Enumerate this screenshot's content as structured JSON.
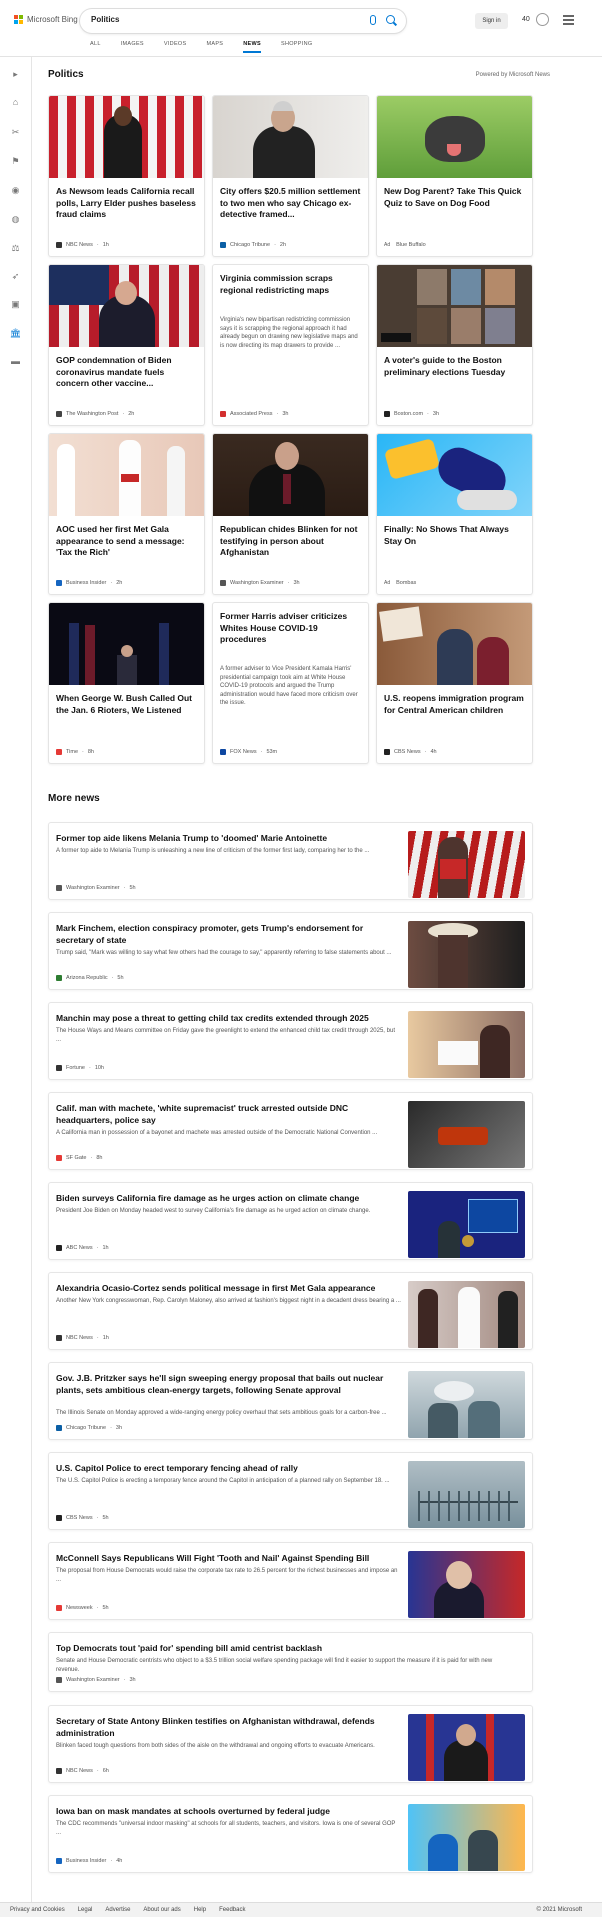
{
  "brand": {
    "name": "Microsoft Bing"
  },
  "search": {
    "query": "Politics"
  },
  "header": {
    "signin": "Sign in",
    "points": "40"
  },
  "tabs": [
    {
      "label": "ALL"
    },
    {
      "label": "IMAGES"
    },
    {
      "label": "VIDEOS"
    },
    {
      "label": "MAPS"
    },
    {
      "label": "NEWS",
      "active": true
    },
    {
      "label": "SHOPPING"
    }
  ],
  "section": {
    "title": "Politics",
    "powered": "Powered by Microsoft News"
  },
  "cards": [
    {
      "title": "As Newsom leads California recall polls, Larry Elder pushes baseless fraud claims",
      "source": "NBC News",
      "age": "1h"
    },
    {
      "title": "City offers $20.5 million settlement to two men who say Chicago ex-detective framed...",
      "source": "Chicago Tribune",
      "age": "2h"
    },
    {
      "title": "New Dog Parent? Take This Quick Quiz to Save on Dog Food",
      "source": "Blue Buffalo",
      "ad": "Ad"
    },
    {
      "title": "GOP condemnation of Biden coronavirus mandate fuels concern other vaccine...",
      "source": "The Washington Post",
      "age": "2h"
    },
    {
      "title": "Virginia commission scraps regional redistricting maps",
      "desc": "Virginia's new bipartisan redistricting commission says it is scrapping the regional approach it had already begun on drawing new legislative maps and is now directing its map drawers to provide ...",
      "source": "Associated Press",
      "age": "3h"
    },
    {
      "title": "A voter's guide to the Boston preliminary elections Tuesday",
      "source": "Boston.com",
      "age": "3h"
    },
    {
      "title": "AOC used her first Met Gala appearance to send a message: 'Tax the Rich'",
      "source": "Business Insider",
      "age": "2h"
    },
    {
      "title": "Republican chides Blinken for not testifying in person about Afghanistan",
      "source": "Washington Examiner",
      "age": "3h"
    },
    {
      "title": "Finally: No Shows That Always Stay On",
      "source": "Bombas",
      "ad": "Ad"
    },
    {
      "title": "When George W. Bush Called Out the Jan. 6 Rioters, We Listened",
      "source": "Time",
      "age": "8h"
    },
    {
      "title": "Former Harris adviser criticizes Whites House COVID-19 procedures",
      "desc": "A former adviser to Vice President Kamala Harris' presidential campaign took aim at White House COVID-19 protocols and argued the Trump administration would have faced more criticism over the issue.",
      "source": "FOX News",
      "age": "53m"
    },
    {
      "title": "U.S. reopens immigration program for Central American children",
      "source": "CBS News",
      "age": "4h"
    }
  ],
  "more": {
    "title": "More news"
  },
  "rows": [
    {
      "title": "Former top aide likens Melania Trump to 'doomed' Marie Antoinette",
      "desc": "A former top aide to Melania Trump is unleashing a new line of criticism of the former first lady, comparing her to the ...",
      "source": "Washington Examiner",
      "age": "5h"
    },
    {
      "title": "Mark Finchem, election conspiracy promoter, gets Trump's endorsement for secretary of state",
      "desc": "Trump said, \"Mark was willing to say what few others had the courage to say,\" apparently referring to false statements about ...",
      "source": "Arizona Republic",
      "age": "5h"
    },
    {
      "title": "Manchin may pose a threat to getting child tax credits extended through 2025",
      "desc": "The House Ways and Means committee on Friday gave the greenlight to extend the enhanced child tax credit through 2025, but ...",
      "source": "Fortune",
      "age": "10h"
    },
    {
      "title": "Calif. man with machete, 'white supremacist' truck arrested outside DNC headquarters, police say",
      "desc": "A California man in possession of a bayonet and machete was arrested outside of the Democratic National Convention ...",
      "source": "SF Gate",
      "age": "8h"
    },
    {
      "title": "Biden surveys California fire damage as he urges action on climate change",
      "desc": "President Joe Biden on Monday headed west to survey California's fire damage as he urged action on climate change.",
      "source": "ABC News",
      "age": "1h"
    },
    {
      "title": "Alexandria Ocasio-Cortez sends political message in first Met Gala appearance",
      "desc": "Another New York congresswoman, Rep. Carolyn Maloney, also arrived at fashion's biggest night in a decadent dress bearing a ...",
      "source": "NBC News",
      "age": "1h"
    },
    {
      "title": "Gov. J.B. Pritzker says he'll sign sweeping energy proposal that bails out nuclear plants, sets ambitious clean-energy targets, following Senate approval",
      "desc": "The Illinois Senate on Monday approved a wide-ranging energy policy overhaul that sets ambitious goals for a carbon-free ...",
      "source": "Chicago Tribune",
      "age": "3h"
    },
    {
      "title": "U.S. Capitol Police to erect temporary fencing ahead of rally",
      "desc": "The U.S. Capitol Police is erecting a temporary fence around the Capitol in anticipation of a planned rally on September 18. ...",
      "source": "CBS News",
      "age": "5h"
    },
    {
      "title": "McConnell Says Republicans Will Fight 'Tooth and Nail' Against Spending Bill",
      "desc": "The proposal from House Democrats would raise the corporate tax rate to 26.5 percent for the richest businesses and impose an ...",
      "source": "Newsweek",
      "age": "5h"
    },
    {
      "title": "Top Democrats tout 'paid for' spending bill amid centrist backlash",
      "desc": "Senate and House Democratic centrists who object to a $3.5 trillion social welfare spending package will find it easier to support the measure if it is paid for with new revenue.",
      "source": "Washington Examiner",
      "age": "3h"
    },
    {
      "title": "Secretary of State Antony Blinken testifies on Afghanistan withdrawal, defends administration",
      "desc": "Blinken faced tough questions from both sides of the aisle on the withdrawal and ongoing efforts to evacuate Americans.",
      "source": "NBC News",
      "age": "6h"
    },
    {
      "title": "Iowa ban on mask mandates at schools overturned by federal judge",
      "desc": "The CDC recommends \"universal indoor masking\" at schools for all students, teachers, and visitors. Iowa is one of several GOP ...",
      "source": "Business Insider",
      "age": "4h"
    }
  ],
  "footer": {
    "links": [
      "Privacy and Cookies",
      "Legal",
      "Advertise",
      "About our ads",
      "Help",
      "Feedback"
    ],
    "copyright": "© 2021 Microsoft"
  }
}
